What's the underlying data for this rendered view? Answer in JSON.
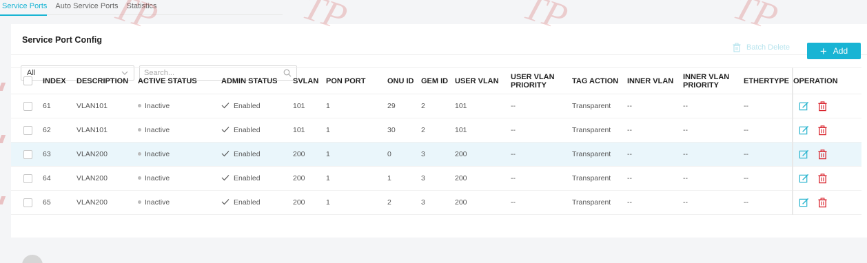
{
  "tabs": [
    {
      "label": "Service Ports",
      "active": true
    },
    {
      "label": "Auto Service Ports",
      "active": false
    },
    {
      "label": "Statistics",
      "active": false
    }
  ],
  "watermark": "TP",
  "card": {
    "title": "Service Port Config"
  },
  "filter": {
    "selected": "All"
  },
  "search": {
    "placeholder": "Search..."
  },
  "toolbar": {
    "batch_delete_label": "Batch Delete",
    "add_label": "Add"
  },
  "colors": {
    "accent": "#18b4d4",
    "delete_icon": "#d9262f",
    "edit_icon": "#2bb5cf",
    "highlight_row": "#eaf6fb"
  },
  "table": {
    "columns": [
      "INDEX",
      "DESCRIPTION",
      "ACTIVE STATUS",
      "ADMIN STATUS",
      "SVLAN",
      "PON PORT",
      "ONU ID",
      "GEM ID",
      "USER VLAN",
      "USER VLAN PRIORITY",
      "TAG ACTION",
      "INNER VLAN",
      "INNER VLAN PRIORITY",
      "ETHERTYPE",
      "OPERATION"
    ],
    "rows": [
      {
        "index": "61",
        "description": "VLAN101",
        "active_status": "Inactive",
        "admin_status": "Enabled",
        "svlan": "101",
        "pon_port": "1",
        "onu_id": "29",
        "gem_id": "2",
        "user_vlan": "101",
        "user_vlan_priority": "--",
        "tag_action": "Transparent",
        "inner_vlan": "--",
        "inner_vlan_priority": "--",
        "ethertype": "--"
      },
      {
        "index": "62",
        "description": "VLAN101",
        "active_status": "Inactive",
        "admin_status": "Enabled",
        "svlan": "101",
        "pon_port": "1",
        "onu_id": "30",
        "gem_id": "2",
        "user_vlan": "101",
        "user_vlan_priority": "--",
        "tag_action": "Transparent",
        "inner_vlan": "--",
        "inner_vlan_priority": "--",
        "ethertype": "--"
      },
      {
        "index": "63",
        "description": "VLAN200",
        "active_status": "Inactive",
        "admin_status": "Enabled",
        "svlan": "200",
        "pon_port": "1",
        "onu_id": "0",
        "gem_id": "3",
        "user_vlan": "200",
        "user_vlan_priority": "--",
        "tag_action": "Transparent",
        "inner_vlan": "--",
        "inner_vlan_priority": "--",
        "ethertype": "--"
      },
      {
        "index": "64",
        "description": "VLAN200",
        "active_status": "Inactive",
        "admin_status": "Enabled",
        "svlan": "200",
        "pon_port": "1",
        "onu_id": "1",
        "gem_id": "3",
        "user_vlan": "200",
        "user_vlan_priority": "--",
        "tag_action": "Transparent",
        "inner_vlan": "--",
        "inner_vlan_priority": "--",
        "ethertype": "--"
      },
      {
        "index": "65",
        "description": "VLAN200",
        "active_status": "Inactive",
        "admin_status": "Enabled",
        "svlan": "200",
        "pon_port": "1",
        "onu_id": "2",
        "gem_id": "3",
        "user_vlan": "200",
        "user_vlan_priority": "--",
        "tag_action": "Transparent",
        "inner_vlan": "--",
        "inner_vlan_priority": "--",
        "ethertype": "--"
      }
    ]
  }
}
